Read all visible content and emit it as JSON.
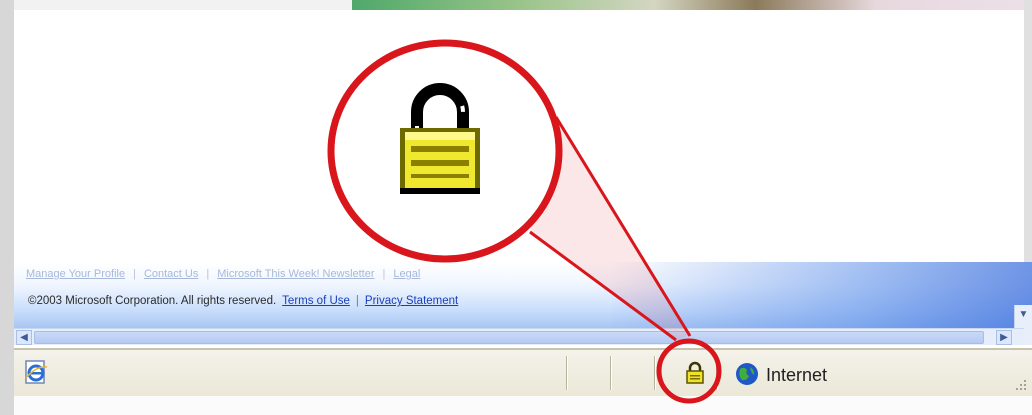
{
  "footer": {
    "links": [
      "Manage Your Profile",
      "Contact Us",
      "Microsoft This Week! Newsletter",
      "Legal"
    ],
    "copyright": "©2003 Microsoft Corporation. All rights reserved.",
    "terms_label": "Terms of Use",
    "privacy_label": "Privacy Statement"
  },
  "status_bar": {
    "zone_label": "Internet",
    "icons": [
      "ie-page-icon",
      "lock-icon",
      "internet-zone-globe-icon",
      "resize-grip-icon"
    ]
  },
  "callout": {
    "icon": "lock-icon",
    "ring_color": "#d8161b"
  },
  "colors": {
    "status_bar_bg": "#ece9d8",
    "link": "#1a3fb8",
    "lock_yellow": "#e8dc2a"
  }
}
